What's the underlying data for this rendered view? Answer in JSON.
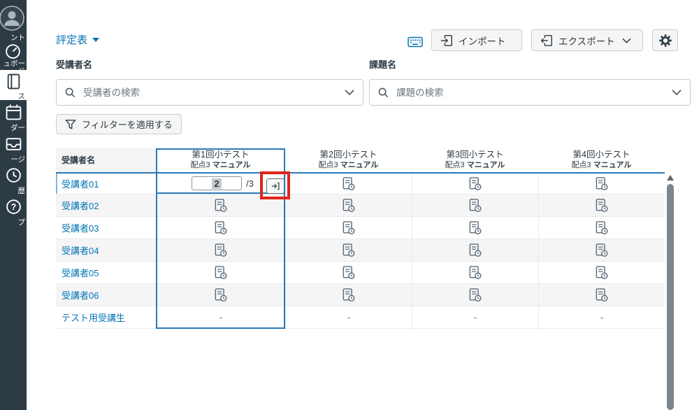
{
  "colors": {
    "sidebar_navy": "#2D3B45",
    "link_blue": "#0374B5",
    "active_column_blue": "#2B7ABC",
    "annotation_red": "#E0241B",
    "button_bg": "#F5F5F5",
    "row_stripe": "#F5F5F6",
    "icon_gray": "#5B6B79"
  },
  "sidebar": {
    "items": [
      {
        "id": "account",
        "icon": "avatar-icon",
        "label_fragment": "ント"
      },
      {
        "id": "dashboard",
        "icon": "dashboard-icon",
        "label_fragment": "ュボー",
        "label_fragment2": "ド"
      },
      {
        "id": "courses",
        "icon": "courses-icon",
        "label_fragment": "ス",
        "active": true
      },
      {
        "id": "calendar",
        "icon": "calendar-icon",
        "label_fragment": "ダー"
      },
      {
        "id": "messages",
        "icon": "inbox-icon",
        "label_fragment": "ージ"
      },
      {
        "id": "history",
        "icon": "history-icon",
        "label_fragment": "歴"
      },
      {
        "id": "help",
        "icon": "help-icon",
        "label_fragment": "プ"
      }
    ]
  },
  "topbar": {
    "gradebook_menu": "評定表",
    "import_label": "インポート",
    "export_label": "エクスポート"
  },
  "filters": {
    "student_name_label": "受講者名",
    "assignment_name_label": "課題名",
    "student_search_placeholder": "受講者の検索",
    "assignment_search_placeholder": "課題の検索",
    "apply_filter_label": "フィルターを適用する"
  },
  "table": {
    "student_header": "受講者名",
    "columns": [
      {
        "title": "第1回小テスト",
        "points": "配点3",
        "grading": "マニュアル"
      },
      {
        "title": "第2回小テスト",
        "points": "配点3",
        "grading": "マニュアル"
      },
      {
        "title": "第3回小テスト",
        "points": "配点3",
        "grading": "マニュアル"
      },
      {
        "title": "第4回小テスト",
        "points": "配点3",
        "grading": "マニュアル"
      }
    ],
    "rows": [
      {
        "name": "受講者01"
      },
      {
        "name": "受講者02"
      },
      {
        "name": "受講者03"
      },
      {
        "name": "受講者04"
      },
      {
        "name": "受講者05"
      },
      {
        "name": "受講者06"
      },
      {
        "name": "テスト用受講生"
      }
    ],
    "score_editor": {
      "value": "2",
      "out_of": "/3"
    },
    "empty_cell": "-"
  }
}
